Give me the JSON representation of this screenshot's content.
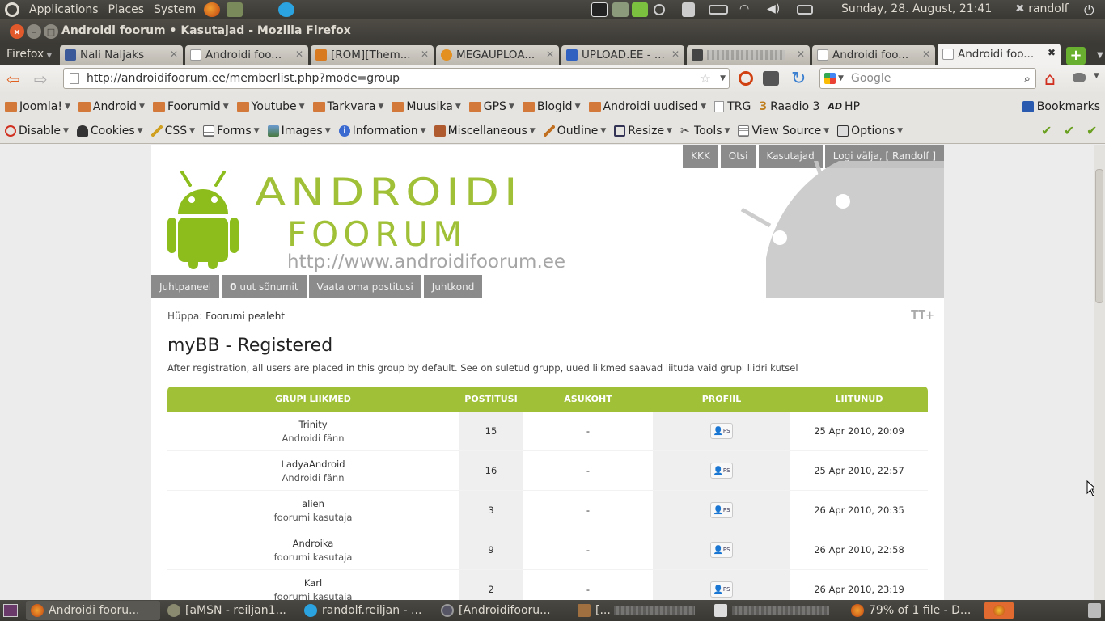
{
  "top_panel": {
    "menus": [
      "Applications",
      "Places",
      "System"
    ],
    "clock": "Sunday, 28. August, 21:41",
    "user": "randolf"
  },
  "window": {
    "title": "Androidi foorum • Kasutajad - Mozilla Firefox"
  },
  "tabs": {
    "firefox_menu": "Firefox",
    "items": [
      {
        "label": "Nali Naljaks"
      },
      {
        "label": "Androidi foo..."
      },
      {
        "label": "[ROM][Them..."
      },
      {
        "label": "MEGAUPLOA..."
      },
      {
        "label": "UPLOAD.EE - ..."
      },
      {
        "label": ""
      },
      {
        "label": "Androidi foo..."
      },
      {
        "label": "Androidi foo..."
      }
    ]
  },
  "nav": {
    "url": "http://androidifoorum.ee/memberlist.php?mode=group",
    "search_placeholder": "Google"
  },
  "bookmarks": {
    "items": [
      {
        "label": "Joomla!"
      },
      {
        "label": "Android"
      },
      {
        "label": "Foorumid"
      },
      {
        "label": "Youtube"
      },
      {
        "label": "Tarkvara"
      },
      {
        "label": "Muusika"
      },
      {
        "label": "GPS"
      },
      {
        "label": "Blogid"
      },
      {
        "label": "Androidi uudised"
      },
      {
        "label": "TRG"
      },
      {
        "label": "Raadio 3"
      },
      {
        "label": "HP"
      }
    ],
    "bookmarks_label": "Bookmarks"
  },
  "devtools": {
    "items": [
      {
        "label": "Disable"
      },
      {
        "label": "Cookies"
      },
      {
        "label": "CSS"
      },
      {
        "label": "Forms"
      },
      {
        "label": "Images"
      },
      {
        "label": "Information"
      },
      {
        "label": "Miscellaneous"
      },
      {
        "label": "Outline"
      },
      {
        "label": "Resize"
      },
      {
        "label": "Tools"
      },
      {
        "label": "View Source"
      },
      {
        "label": "Options"
      }
    ]
  },
  "forum": {
    "top_links": [
      "KKK",
      "Otsi",
      "Kasutajad",
      "Logi välja, [ Randolf ]"
    ],
    "logo_line1": "ANDROIDI",
    "logo_line2": "FOORUM",
    "logo_url": "http://www.androidifoorum.ee",
    "nav": {
      "control_panel": "Juhtpaneel",
      "new_messages_count": "0",
      "new_messages_label": " uut sõnumit",
      "own_posts": "Vaata oma postitusi",
      "team": "Juhtkond"
    },
    "jump_label": "Hüppa:",
    "jump_link": "Foorumi pealeht",
    "group_title": "myBB - Registered",
    "group_description": "After registration, all users are placed in this group by default. See on suletud grupp, uued liikmed saavad liituda vaid grupi liidri kutsel",
    "columns": [
      "GRUPI LIIKMED",
      "POSTITUSI",
      "ASUKOHT",
      "PROFIIL",
      "LIITUNUD"
    ],
    "members": [
      {
        "name": "Trinity",
        "rank": "Androidi fänn",
        "posts": "15",
        "location": "-",
        "joined": "25 Apr 2010, 20:09"
      },
      {
        "name": "LadyaAndroid",
        "rank": "Androidi fänn",
        "posts": "16",
        "location": "-",
        "joined": "25 Apr 2010, 22:57"
      },
      {
        "name": "alien",
        "rank": "foorumi kasutaja",
        "posts": "3",
        "location": "-",
        "joined": "26 Apr 2010, 20:35"
      },
      {
        "name": "Androika",
        "rank": "foorumi kasutaja",
        "posts": "9",
        "location": "-",
        "joined": "26 Apr 2010, 22:58"
      },
      {
        "name": "Karl",
        "rank": "foorumi kasutaja",
        "posts": "2",
        "location": "-",
        "joined": "26 Apr 2010, 23:19"
      }
    ],
    "pm_label": "PS"
  },
  "taskbar": {
    "items": [
      {
        "label": "Androidi fooru..."
      },
      {
        "label": "[aMSN - reiljan1..."
      },
      {
        "label": "randolf.reiljan - ..."
      },
      {
        "label": "[Androidifooru..."
      },
      {
        "label": "[..."
      },
      {
        "label": ""
      },
      {
        "label": "79% of 1 file - D..."
      }
    ]
  },
  "colors": {
    "forum_green": "#a0c037",
    "nav_gray": "#8b8b8b",
    "ubuntu_dark": "#3c3a35"
  }
}
